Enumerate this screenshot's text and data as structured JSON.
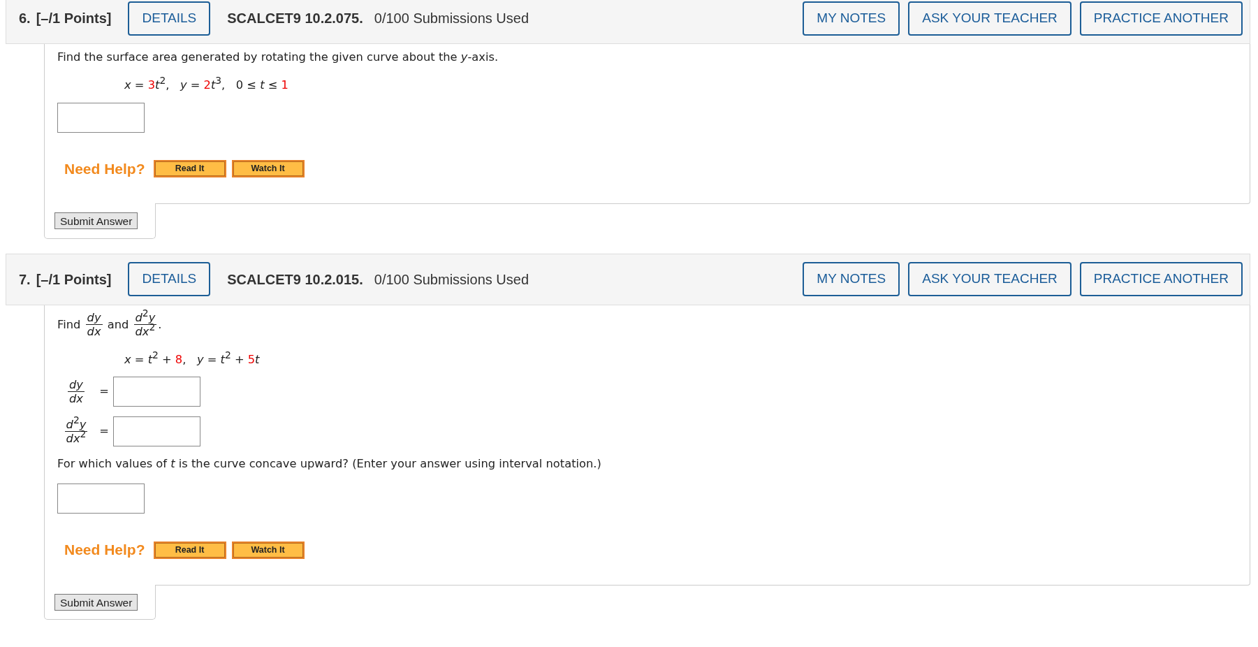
{
  "questions": [
    {
      "number": "6.",
      "points": "[–/1 Points]",
      "details_button": "DETAILS",
      "code": "SCALCET9 10.2.075.",
      "submissions": "0/100 Submissions Used",
      "header_buttons": [
        "MY NOTES",
        "ASK YOUR TEACHER",
        "PRACTICE ANOTHER"
      ],
      "blocks": [
        {
          "kind": "text",
          "parts": [
            {
              "kind": "text",
              "text": "Find the surface area generated by rotating the given curve about the *y*-axis."
            }
          ]
        },
        {
          "kind": "equation",
          "parts": [
            {
              "text": "*x* = ",
              "highlighted": false
            },
            {
              "text": "3",
              "highlighted": true
            },
            {
              "text": "*t*$^{2}$,   *y* = ",
              "highlighted": false
            },
            {
              "text": "2",
              "highlighted": true
            },
            {
              "text": "*t*$^{3}$,   0 ≤ *t* ≤ ",
              "highlighted": false
            },
            {
              "text": "1",
              "highlighted": true
            }
          ]
        },
        {
          "kind": "answer"
        }
      ],
      "help_label": "Need Help?",
      "help_buttons": [
        "Read It",
        "Watch It"
      ],
      "submit_button": "Submit Answer"
    },
    {
      "number": "7.",
      "points": "[–/1 Points]",
      "details_button": "DETAILS",
      "code": "SCALCET9 10.2.015.",
      "submissions": "0/100 Submissions Used",
      "header_buttons": [
        "MY NOTES",
        "ASK YOUR TEACHER",
        "PRACTICE ANOTHER"
      ],
      "blocks": [
        {
          "kind": "text",
          "parts": [
            {
              "kind": "text",
              "text": "Find "
            },
            {
              "kind": "fraction",
              "numerator": "*dy*",
              "denominator": "*dx*"
            },
            {
              "kind": "text",
              "text": " and "
            },
            {
              "kind": "fraction",
              "numerator": "*d*$^{2}$*y*",
              "denominator": "*dx*$^{2}$"
            },
            {
              "kind": "text",
              "text": "."
            }
          ]
        },
        {
          "kind": "equation",
          "parts": [
            {
              "text": "*x* = *t*$^{2}$ + ",
              "highlighted": false
            },
            {
              "text": "8",
              "highlighted": true
            },
            {
              "text": ",   *y* = *t*$^{2}$ + ",
              "highlighted": false
            },
            {
              "text": "5",
              "highlighted": true
            },
            {
              "text": "*t*",
              "highlighted": false
            }
          ]
        },
        {
          "kind": "answer",
          "label": {
            "numerator": "*dy*",
            "denominator": "*dx*",
            "relation": "="
          }
        },
        {
          "kind": "answer",
          "label": {
            "numerator": "*d*$^{2}$*y*",
            "denominator": "*dx*$^{2}$",
            "relation": "="
          }
        },
        {
          "kind": "text",
          "parts": [
            {
              "kind": "text",
              "text": "For which values of *t* is the curve concave upward? (Enter your answer using interval notation.)"
            }
          ]
        },
        {
          "kind": "answer"
        }
      ],
      "help_label": "Need Help?",
      "help_buttons": [
        "Read It",
        "Watch It"
      ],
      "submit_button": "Submit Answer"
    }
  ]
}
